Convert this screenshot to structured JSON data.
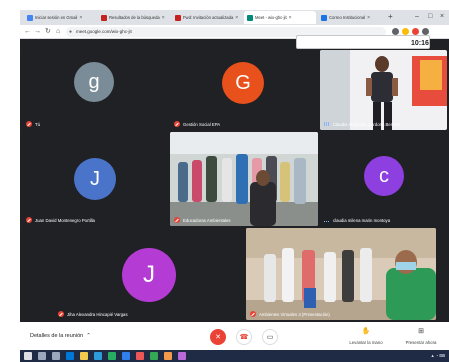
{
  "browser": {
    "tabs": [
      {
        "label": "Iniciar sesión en Gmail",
        "color": "#4285f4"
      },
      {
        "label": "Resultados de la búsqueda",
        "color": "#c5221f"
      },
      {
        "label": "Fwd: Invitación actualizada",
        "color": "#c5221f"
      },
      {
        "label": "Meet - wix-ghc-jit",
        "color": "#00897b"
      },
      {
        "label": "Correo Institucional",
        "color": "#1a73e8"
      }
    ],
    "address": "meet.google.com/wix-ghc-jit",
    "time": "10:16"
  },
  "meet": {
    "participants": [
      {
        "name": "Tú",
        "initial": "g",
        "avatar_color": "#7a8c97",
        "muted": true
      },
      {
        "name": "Gestión Social EPA",
        "initial": "G",
        "avatar_color": "#e8501c",
        "muted": true
      },
      {
        "name": "Claudia Alejandra Cardona Benitez",
        "initial": "",
        "video": true,
        "muted": false
      },
      {
        "name": "Juan David Montenegro Portilla",
        "initial": "J",
        "avatar_color": "#4a74c9",
        "muted": true
      },
      {
        "name": "Educadoras Ambientales",
        "initial": "",
        "video": true,
        "muted": true
      },
      {
        "name": "claudia milena marin montoya",
        "initial": "c",
        "avatar_color": "#8e3fe0",
        "muted": false
      },
      {
        "name": "Jiha Alexandra Hincapié Vargas",
        "initial": "J",
        "avatar_color": "#b43bd3",
        "muted": true
      },
      {
        "name": "Ambientes Virtuales 3 (Presentación)",
        "initial": "",
        "video": true,
        "muted": true
      }
    ],
    "bottom": {
      "details": "Detalles de la reunión",
      "raise_hand": "Levantar la mano",
      "present": "Presentar ahora"
    }
  }
}
